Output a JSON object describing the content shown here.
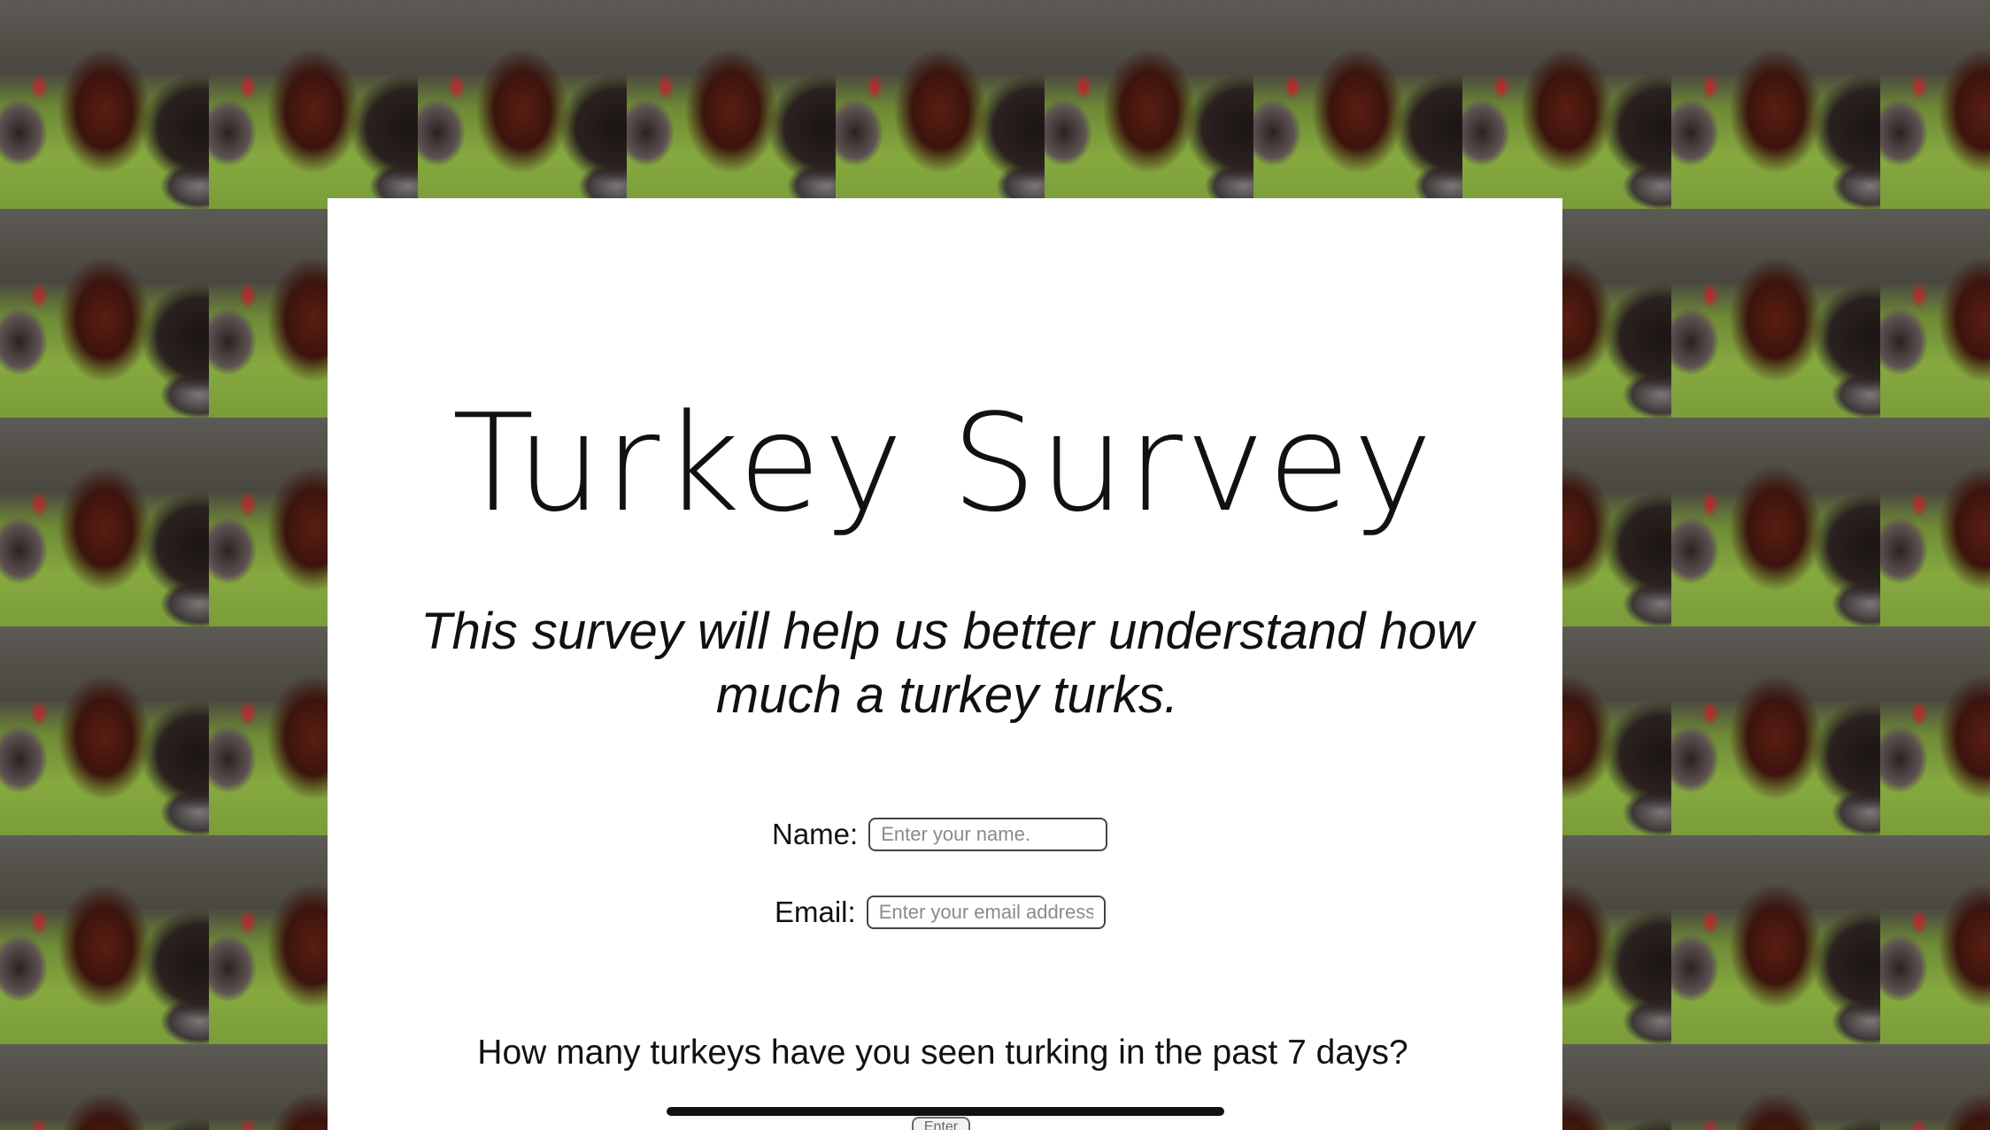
{
  "page": {
    "title": "Turkey Survey",
    "description": "This survey will help us better understand how much a turkey turks."
  },
  "form": {
    "name": {
      "label": "Name:",
      "placeholder": "Enter your name.",
      "value": ""
    },
    "email": {
      "label": "Email:",
      "placeholder": "Enter your email address.",
      "value": ""
    },
    "question_turkeys": {
      "label": "How many turkeys have you seen turking in the past 7 days?"
    },
    "submit_button": {
      "label": "Enter"
    }
  },
  "background": {
    "image": "turkey-photo-tiled"
  }
}
